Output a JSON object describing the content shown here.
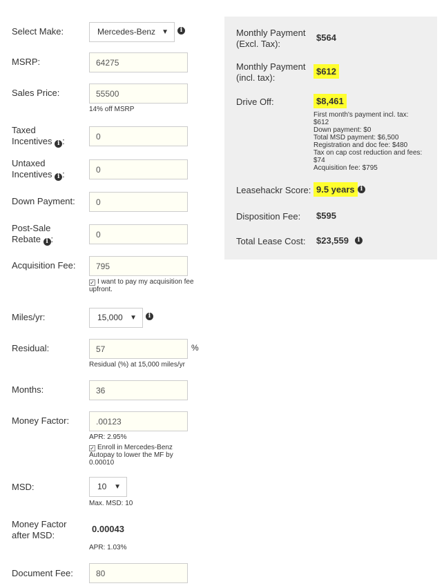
{
  "form": {
    "make": {
      "label": "Select Make:",
      "value": "Mercedes-Benz"
    },
    "msrp": {
      "label": "MSRP:",
      "value": "64275"
    },
    "sales_price": {
      "label": "Sales Price:",
      "value": "55500",
      "note": "14% off MSRP"
    },
    "taxed_incentives": {
      "label_line1": "Taxed",
      "label_line2": "Incentives",
      "value": "0"
    },
    "untaxed_incentives": {
      "label_line1": "Untaxed",
      "label_line2": "Incentives",
      "value": "0"
    },
    "down_payment": {
      "label": "Down Payment:",
      "value": "0"
    },
    "post_sale_rebate": {
      "label_line1": "Post-Sale",
      "label_line2": "Rebate",
      "value": "0"
    },
    "acquisition_fee": {
      "label": "Acquisition Fee:",
      "value": "795",
      "checkbox_label": "I want to pay my acquisition fee upfront.",
      "checked": true
    },
    "miles": {
      "label": "Miles/yr:",
      "value": "15,000"
    },
    "residual": {
      "label": "Residual:",
      "value": "57",
      "unit": "%",
      "note": "Residual (%) at 15,000 miles/yr"
    },
    "months": {
      "label": "Months:",
      "value": "36"
    },
    "money_factor": {
      "label": "Money Factor:",
      "value": ".00123",
      "apr": "APR: 2.95%",
      "checkbox_label": "Enroll in Mercedes-Benz Autopay to lower the MF by 0.00010",
      "checked": true
    },
    "msd": {
      "label": "MSD:",
      "value": "10",
      "note": "Max. MSD: 10"
    },
    "mf_after_msd": {
      "label_line1": "Money Factor",
      "label_line2": "after MSD:",
      "value": "0.00043",
      "apr": "APR: 1.03%"
    },
    "document_fee": {
      "label": "Document Fee:",
      "value": "80"
    }
  },
  "summary": {
    "monthly_excl": {
      "label_line1": "Monthly Payment",
      "label_line2": "(Excl. Tax):",
      "value": "$564"
    },
    "monthly_incl": {
      "label_line1": "Monthly Payment",
      "label_line2": "(incl. tax):",
      "value": "$612"
    },
    "drive_off": {
      "label": "Drive Off:",
      "value": "$8,461",
      "details": [
        "First month's payment incl. tax: $612",
        "Down payment: $0",
        "Total MSD payment: $6,500",
        "Registration and doc fee: $480",
        "Tax on cap cost reduction and fees: $74",
        "Acquisition fee: $795"
      ]
    },
    "score": {
      "label": "Leasehackr Score:",
      "value": "9.5 years"
    },
    "disposition": {
      "label": "Disposition Fee:",
      "value": "$595"
    },
    "total_cost": {
      "label": "Total Lease Cost:",
      "value": "$23,559"
    }
  },
  "colors": {
    "highlight": "#ffff2e",
    "panel_bg": "#efefef",
    "input_bg": "#fffff4"
  },
  "icons": {
    "info": "info-circle-icon",
    "caret": "caret-down-icon",
    "check": "check-icon"
  }
}
